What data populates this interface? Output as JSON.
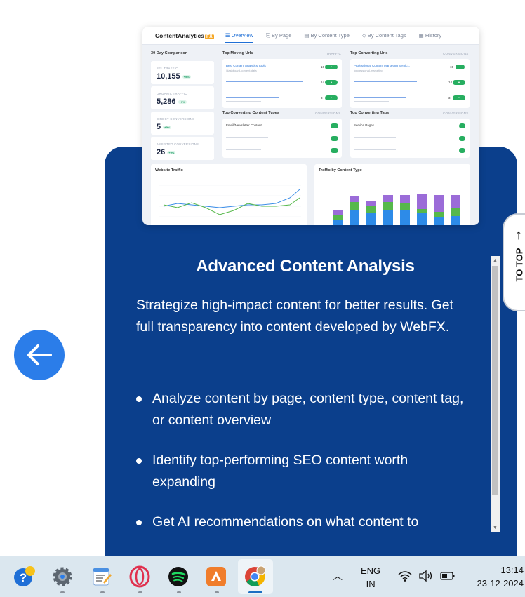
{
  "dashboard": {
    "brand": "ContentAnalytics",
    "brand_badge": "FX",
    "tabs": [
      "Overview",
      "By Page",
      "By Content Type",
      "By Content Tags",
      "History"
    ],
    "comparison_title": "30 Day Comparison",
    "stats": [
      {
        "label": "SEL TRAFFIC",
        "value": "10,155",
        "change": "+9%"
      },
      {
        "label": "ORGANIC TRAFFIC",
        "value": "5,286",
        "change": "+9%"
      },
      {
        "label": "DIRECT CONVERSIONS",
        "value": "5",
        "change": "+9%"
      },
      {
        "label": "ASSISTED CONVERSIONS",
        "value": "26",
        "change": "+9%"
      }
    ],
    "top_moving": {
      "title": "Top Moving Urls",
      "meta": "TRAFFIC",
      "first_link": "Best Content Analytics Tools",
      "first_sub": "/dashboard-content-data",
      "counts": [
        "16",
        "14",
        "3"
      ]
    },
    "top_converting_urls": {
      "title": "Top Converting Urls",
      "meta": "CONVERSIONS",
      "first_link": "Professional Content Marketing Servic...",
      "first_sub": "/professional-marketing",
      "counts": [
        "15",
        "14",
        "3"
      ]
    },
    "content_types": {
      "title": "Top Converting Content Types",
      "meta": "CONVERSIONS",
      "first_item": "Email/Newsletter Content"
    },
    "content_tags": {
      "title": "Top Converting Tags",
      "meta": "CONVERSIONS",
      "first_item": "Service Pages"
    },
    "website_traffic_title": "Website Traffic",
    "traffic_by_type_title": "Traffic by Content Type"
  },
  "feature": {
    "title": "Advanced Content Analysis",
    "description": "Strategize high-impact content for better results. Get full transparency into content developed by WebFX.",
    "bullets": [
      "Analyze content by page, content type, content tag, or content overview",
      "Identify top-performing SEO content worth expanding",
      "Get AI recommendations on what content to"
    ]
  },
  "to_top": {
    "arrow": "↑",
    "label": "TO TOP"
  },
  "taskbar": {
    "language_line1": "ENG",
    "language_line2": "IN",
    "time": "13:14",
    "date": "23-12-2024"
  },
  "colors": {
    "card_blue": "#0b3f8c",
    "accent_blue": "#2b7de9",
    "pill_green": "#27ae60"
  }
}
